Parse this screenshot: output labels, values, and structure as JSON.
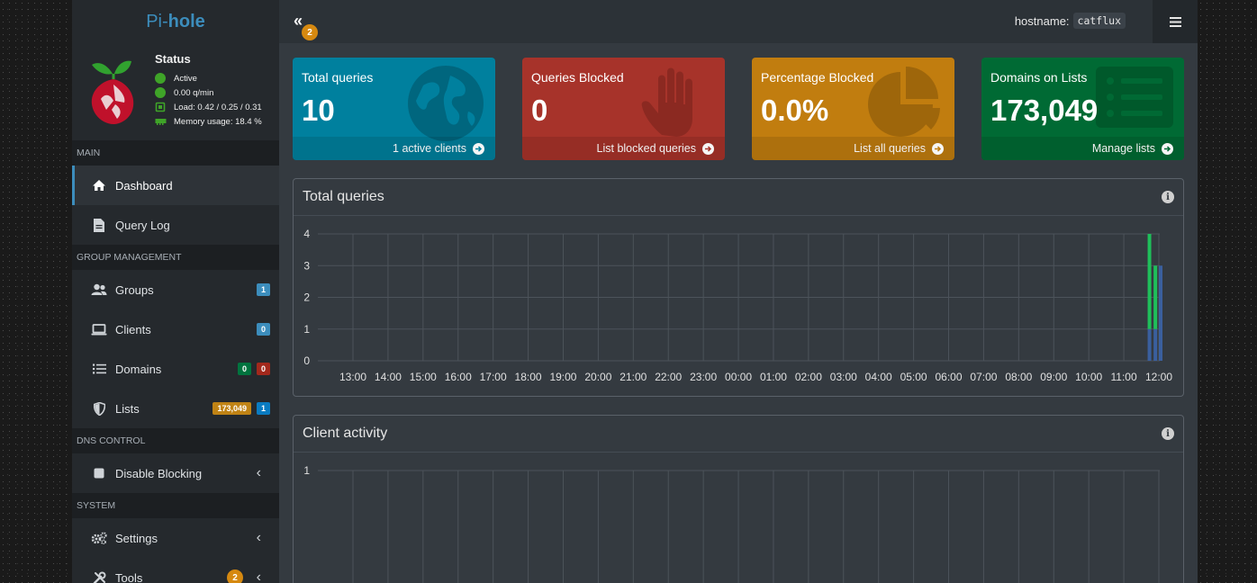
{
  "sidebar": {
    "brand_prefix": "Pi-",
    "brand_bold": "hole",
    "status": {
      "title": "Status",
      "active": "Active",
      "rate": "0.00 q/min",
      "load": "Load: 0.42 / 0.25 / 0.31",
      "memory": "Memory usage: 18.4 %"
    },
    "sections": {
      "main": "MAIN",
      "group": "GROUP MANAGEMENT",
      "dns": "DNS CONTROL",
      "system": "SYSTEM"
    },
    "items": {
      "dashboard": "Dashboard",
      "querylog": "Query Log",
      "groups": "Groups",
      "groups_badge": "1",
      "clients": "Clients",
      "clients_badge": "0",
      "domains": "Domains",
      "domains_allow": "0",
      "domains_deny": "0",
      "lists": "Lists",
      "lists_count": "173,049",
      "lists_badge": "1",
      "disable": "Disable Blocking",
      "settings": "Settings",
      "tools": "Tools",
      "tools_badge": "2"
    },
    "colors": {
      "active_green": "#3fa428",
      "accent": "#3c8dbc"
    }
  },
  "header": {
    "toggle_badge": "2",
    "hostname_label": "hostname:",
    "hostname_value": "catflux",
    "icons": {
      "toggle": "angles-left-icon",
      "menu": "hamburger-icon"
    }
  },
  "boxes": [
    {
      "title": "Total queries",
      "value": "10",
      "footer": "1 active clients",
      "color": "#00809e",
      "icon": "globe-icon"
    },
    {
      "title": "Queries Blocked",
      "value": "0",
      "footer": "List blocked queries",
      "color": "#a7332a",
      "icon": "hand-icon"
    },
    {
      "title": "Percentage Blocked",
      "value": "0.0%",
      "footer": "List all queries",
      "color": "#c17d0f",
      "icon": "pie-chart-icon"
    },
    {
      "title": "Domains on Lists",
      "value": "173,049",
      "footer": "Manage lists",
      "color": "#006a34",
      "icon": "list-icon"
    }
  ],
  "cards": {
    "total_title": "Total queries",
    "client_title": "Client activity"
  },
  "chart_data": [
    {
      "type": "bar",
      "title": "Total queries",
      "x_ticks": [
        "13:00",
        "14:00",
        "15:00",
        "16:00",
        "17:00",
        "18:00",
        "19:00",
        "20:00",
        "21:00",
        "22:00",
        "23:00",
        "00:00",
        "01:00",
        "02:00",
        "03:00",
        "04:00",
        "05:00",
        "06:00",
        "07:00",
        "08:00",
        "09:00",
        "10:00",
        "11:00",
        "12:00"
      ],
      "ylim": [
        0,
        4
      ],
      "y_ticks": [
        0,
        1,
        2,
        3,
        4
      ],
      "grid": true,
      "stacked": true,
      "bar_slots": [
        {
          "after_tick": "11:00",
          "fraction": 0.68,
          "segments": [
            {
              "color": "#3a5f9e",
              "value": 1
            },
            {
              "color": "#1fbf5a",
              "value": 3
            }
          ]
        },
        {
          "after_tick": "11:00",
          "fraction": 0.85,
          "segments": [
            {
              "color": "#3a5f9e",
              "value": 1
            },
            {
              "color": "#1fbf5a",
              "value": 2
            }
          ]
        },
        {
          "after_tick": "12:00",
          "fraction": 0.0,
          "segments": [
            {
              "color": "#3a5f9e",
              "value": 3
            }
          ]
        }
      ]
    },
    {
      "type": "bar",
      "title": "Client activity",
      "x_ticks": [
        "13:00",
        "14:00",
        "15:00",
        "16:00",
        "17:00",
        "18:00",
        "19:00",
        "20:00",
        "21:00",
        "22:00",
        "23:00",
        "00:00",
        "01:00",
        "02:00",
        "03:00",
        "04:00",
        "05:00",
        "06:00",
        "07:00",
        "08:00",
        "09:00",
        "10:00",
        "11:00",
        "12:00"
      ],
      "y_ticks": [
        1
      ],
      "grid": true
    }
  ]
}
